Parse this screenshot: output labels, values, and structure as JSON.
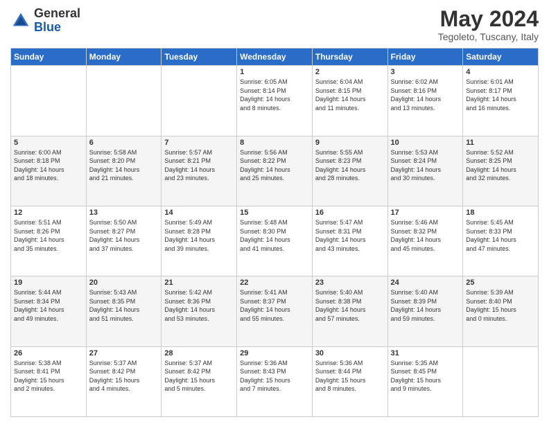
{
  "header": {
    "logo_general": "General",
    "logo_blue": "Blue",
    "month_title": "May 2024",
    "location": "Tegoleto, Tuscany, Italy"
  },
  "days_of_week": [
    "Sunday",
    "Monday",
    "Tuesday",
    "Wednesday",
    "Thursday",
    "Friday",
    "Saturday"
  ],
  "weeks": [
    [
      {
        "num": "",
        "info": ""
      },
      {
        "num": "",
        "info": ""
      },
      {
        "num": "",
        "info": ""
      },
      {
        "num": "1",
        "info": "Sunrise: 6:05 AM\nSunset: 8:14 PM\nDaylight: 14 hours\nand 8 minutes."
      },
      {
        "num": "2",
        "info": "Sunrise: 6:04 AM\nSunset: 8:15 PM\nDaylight: 14 hours\nand 11 minutes."
      },
      {
        "num": "3",
        "info": "Sunrise: 6:02 AM\nSunset: 8:16 PM\nDaylight: 14 hours\nand 13 minutes."
      },
      {
        "num": "4",
        "info": "Sunrise: 6:01 AM\nSunset: 8:17 PM\nDaylight: 14 hours\nand 16 minutes."
      }
    ],
    [
      {
        "num": "5",
        "info": "Sunrise: 6:00 AM\nSunset: 8:18 PM\nDaylight: 14 hours\nand 18 minutes."
      },
      {
        "num": "6",
        "info": "Sunrise: 5:58 AM\nSunset: 8:20 PM\nDaylight: 14 hours\nand 21 minutes."
      },
      {
        "num": "7",
        "info": "Sunrise: 5:57 AM\nSunset: 8:21 PM\nDaylight: 14 hours\nand 23 minutes."
      },
      {
        "num": "8",
        "info": "Sunrise: 5:56 AM\nSunset: 8:22 PM\nDaylight: 14 hours\nand 25 minutes."
      },
      {
        "num": "9",
        "info": "Sunrise: 5:55 AM\nSunset: 8:23 PM\nDaylight: 14 hours\nand 28 minutes."
      },
      {
        "num": "10",
        "info": "Sunrise: 5:53 AM\nSunset: 8:24 PM\nDaylight: 14 hours\nand 30 minutes."
      },
      {
        "num": "11",
        "info": "Sunrise: 5:52 AM\nSunset: 8:25 PM\nDaylight: 14 hours\nand 32 minutes."
      }
    ],
    [
      {
        "num": "12",
        "info": "Sunrise: 5:51 AM\nSunset: 8:26 PM\nDaylight: 14 hours\nand 35 minutes."
      },
      {
        "num": "13",
        "info": "Sunrise: 5:50 AM\nSunset: 8:27 PM\nDaylight: 14 hours\nand 37 minutes."
      },
      {
        "num": "14",
        "info": "Sunrise: 5:49 AM\nSunset: 8:28 PM\nDaylight: 14 hours\nand 39 minutes."
      },
      {
        "num": "15",
        "info": "Sunrise: 5:48 AM\nSunset: 8:30 PM\nDaylight: 14 hours\nand 41 minutes."
      },
      {
        "num": "16",
        "info": "Sunrise: 5:47 AM\nSunset: 8:31 PM\nDaylight: 14 hours\nand 43 minutes."
      },
      {
        "num": "17",
        "info": "Sunrise: 5:46 AM\nSunset: 8:32 PM\nDaylight: 14 hours\nand 45 minutes."
      },
      {
        "num": "18",
        "info": "Sunrise: 5:45 AM\nSunset: 8:33 PM\nDaylight: 14 hours\nand 47 minutes."
      }
    ],
    [
      {
        "num": "19",
        "info": "Sunrise: 5:44 AM\nSunset: 8:34 PM\nDaylight: 14 hours\nand 49 minutes."
      },
      {
        "num": "20",
        "info": "Sunrise: 5:43 AM\nSunset: 8:35 PM\nDaylight: 14 hours\nand 51 minutes."
      },
      {
        "num": "21",
        "info": "Sunrise: 5:42 AM\nSunset: 8:36 PM\nDaylight: 14 hours\nand 53 minutes."
      },
      {
        "num": "22",
        "info": "Sunrise: 5:41 AM\nSunset: 8:37 PM\nDaylight: 14 hours\nand 55 minutes."
      },
      {
        "num": "23",
        "info": "Sunrise: 5:40 AM\nSunset: 8:38 PM\nDaylight: 14 hours\nand 57 minutes."
      },
      {
        "num": "24",
        "info": "Sunrise: 5:40 AM\nSunset: 8:39 PM\nDaylight: 14 hours\nand 59 minutes."
      },
      {
        "num": "25",
        "info": "Sunrise: 5:39 AM\nSunset: 8:40 PM\nDaylight: 15 hours\nand 0 minutes."
      }
    ],
    [
      {
        "num": "26",
        "info": "Sunrise: 5:38 AM\nSunset: 8:41 PM\nDaylight: 15 hours\nand 2 minutes."
      },
      {
        "num": "27",
        "info": "Sunrise: 5:37 AM\nSunset: 8:42 PM\nDaylight: 15 hours\nand 4 minutes."
      },
      {
        "num": "28",
        "info": "Sunrise: 5:37 AM\nSunset: 8:42 PM\nDaylight: 15 hours\nand 5 minutes."
      },
      {
        "num": "29",
        "info": "Sunrise: 5:36 AM\nSunset: 8:43 PM\nDaylight: 15 hours\nand 7 minutes."
      },
      {
        "num": "30",
        "info": "Sunrise: 5:36 AM\nSunset: 8:44 PM\nDaylight: 15 hours\nand 8 minutes."
      },
      {
        "num": "31",
        "info": "Sunrise: 5:35 AM\nSunset: 8:45 PM\nDaylight: 15 hours\nand 9 minutes."
      },
      {
        "num": "",
        "info": ""
      }
    ]
  ]
}
